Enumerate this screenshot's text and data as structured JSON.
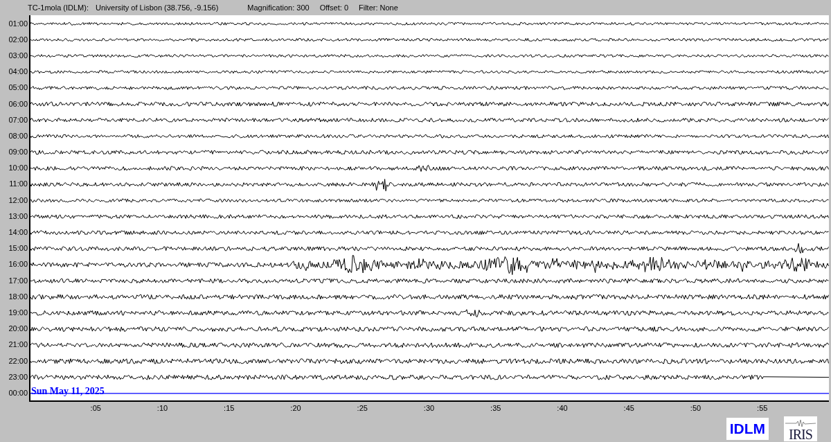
{
  "header": {
    "station": "TC-1mola (IDLM):",
    "location": "University of Lisbon (38.756, -9.156)",
    "magnification": "Magnification: 300",
    "offset": "Offset: 0",
    "filter": "Filter: None"
  },
  "rows": [
    {
      "label": "01:00",
      "kind": "trace"
    },
    {
      "label": "02:00",
      "kind": "trace"
    },
    {
      "label": "03:00",
      "kind": "trace"
    },
    {
      "label": "04:00",
      "kind": "trace"
    },
    {
      "label": "05:00",
      "kind": "trace"
    },
    {
      "label": "06:00",
      "kind": "trace"
    },
    {
      "label": "07:00",
      "kind": "trace"
    },
    {
      "label": "08:00",
      "kind": "trace"
    },
    {
      "label": "09:00",
      "kind": "trace"
    },
    {
      "label": "10:00",
      "kind": "trace"
    },
    {
      "label": "11:00",
      "kind": "trace"
    },
    {
      "label": "12:00",
      "kind": "trace"
    },
    {
      "label": "13:00",
      "kind": "trace"
    },
    {
      "label": "14:00",
      "kind": "trace"
    },
    {
      "label": "15:00",
      "kind": "trace"
    },
    {
      "label": "16:00",
      "kind": "trace"
    },
    {
      "label": "17:00",
      "kind": "trace"
    },
    {
      "label": "18:00",
      "kind": "trace"
    },
    {
      "label": "19:00",
      "kind": "trace"
    },
    {
      "label": "20:00",
      "kind": "trace"
    },
    {
      "label": "21:00",
      "kind": "trace"
    },
    {
      "label": "22:00",
      "kind": "trace"
    },
    {
      "label": "23:00",
      "kind": "partial"
    },
    {
      "label": "00:00",
      "kind": "current"
    }
  ],
  "date": "Sun May 11, 2025",
  "x_ticks": [
    ":05",
    ":10",
    ":15",
    ":20",
    ":25",
    ":30",
    ":35",
    ":40",
    ":45",
    ":50",
    ":55"
  ],
  "logos": {
    "station": "IDLM",
    "network": "IRIS"
  }
}
